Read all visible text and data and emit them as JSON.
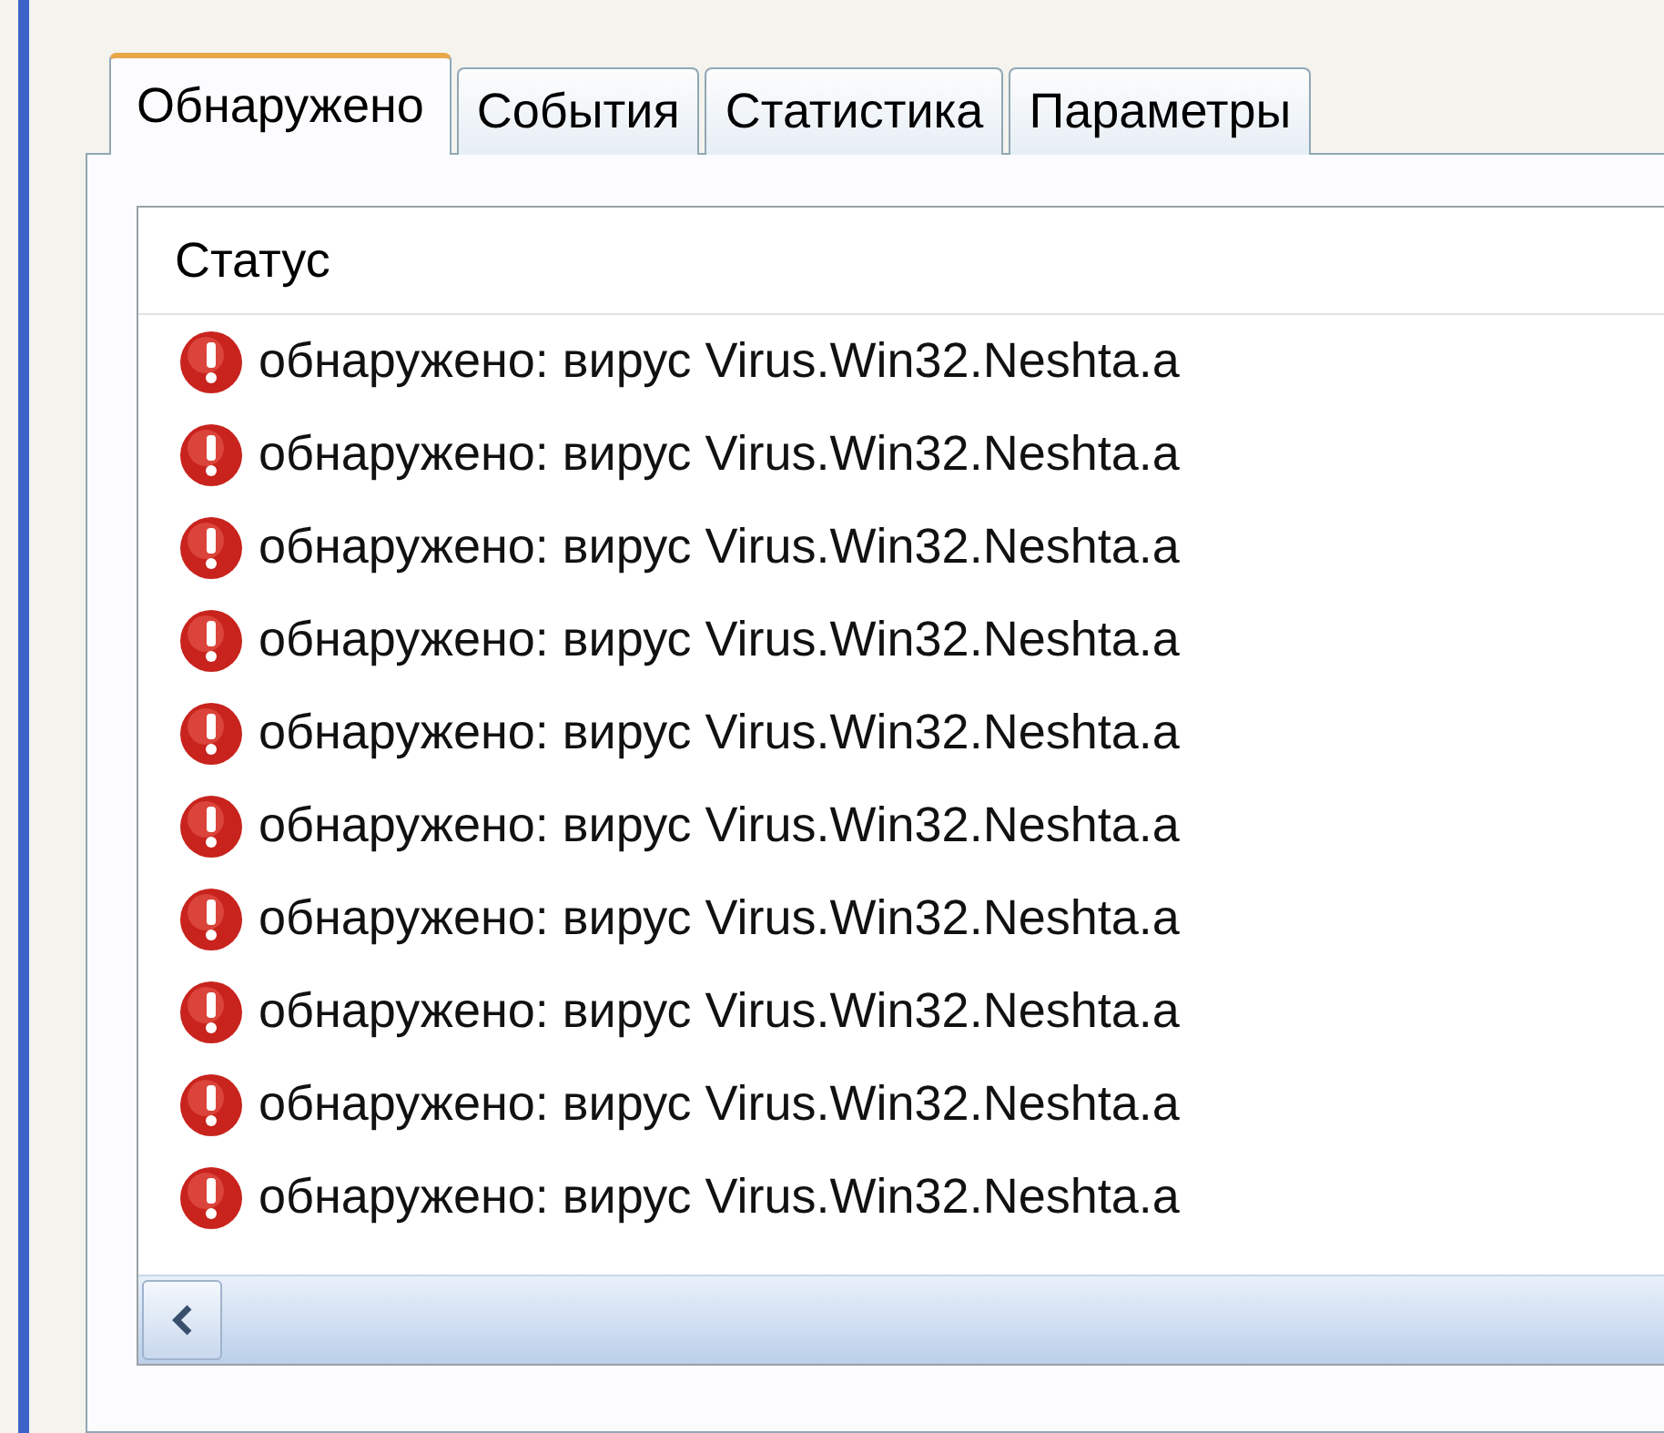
{
  "tabs": [
    {
      "label": "Обнаружено",
      "selected": true
    },
    {
      "label": "События",
      "selected": false
    },
    {
      "label": "Статистика",
      "selected": false
    },
    {
      "label": "Параметры",
      "selected": false
    }
  ],
  "list": {
    "columns": [
      "Статус"
    ],
    "rows": [
      {
        "status": "обнаружено: вирус Virus.Win32.Neshta.a",
        "kind": "threat"
      },
      {
        "status": "обнаружено: вирус Virus.Win32.Neshta.a",
        "kind": "threat"
      },
      {
        "status": "обнаружено: вирус Virus.Win32.Neshta.a",
        "kind": "threat"
      },
      {
        "status": "обнаружено: вирус Virus.Win32.Neshta.a",
        "kind": "threat"
      },
      {
        "status": "обнаружено: вирус Virus.Win32.Neshta.a",
        "kind": "threat"
      },
      {
        "status": "обнаружено: вирус Virus.Win32.Neshta.a",
        "kind": "threat"
      },
      {
        "status": "обнаружено: вирус Virus.Win32.Neshta.a",
        "kind": "threat"
      },
      {
        "status": "обнаружено: вирус Virus.Win32.Neshta.a",
        "kind": "threat"
      },
      {
        "status": "обнаружено: вирус Virus.Win32.Neshta.a",
        "kind": "threat"
      },
      {
        "status": "обнаружено: вирус Virus.Win32.Neshta.a",
        "kind": "threat"
      }
    ]
  }
}
